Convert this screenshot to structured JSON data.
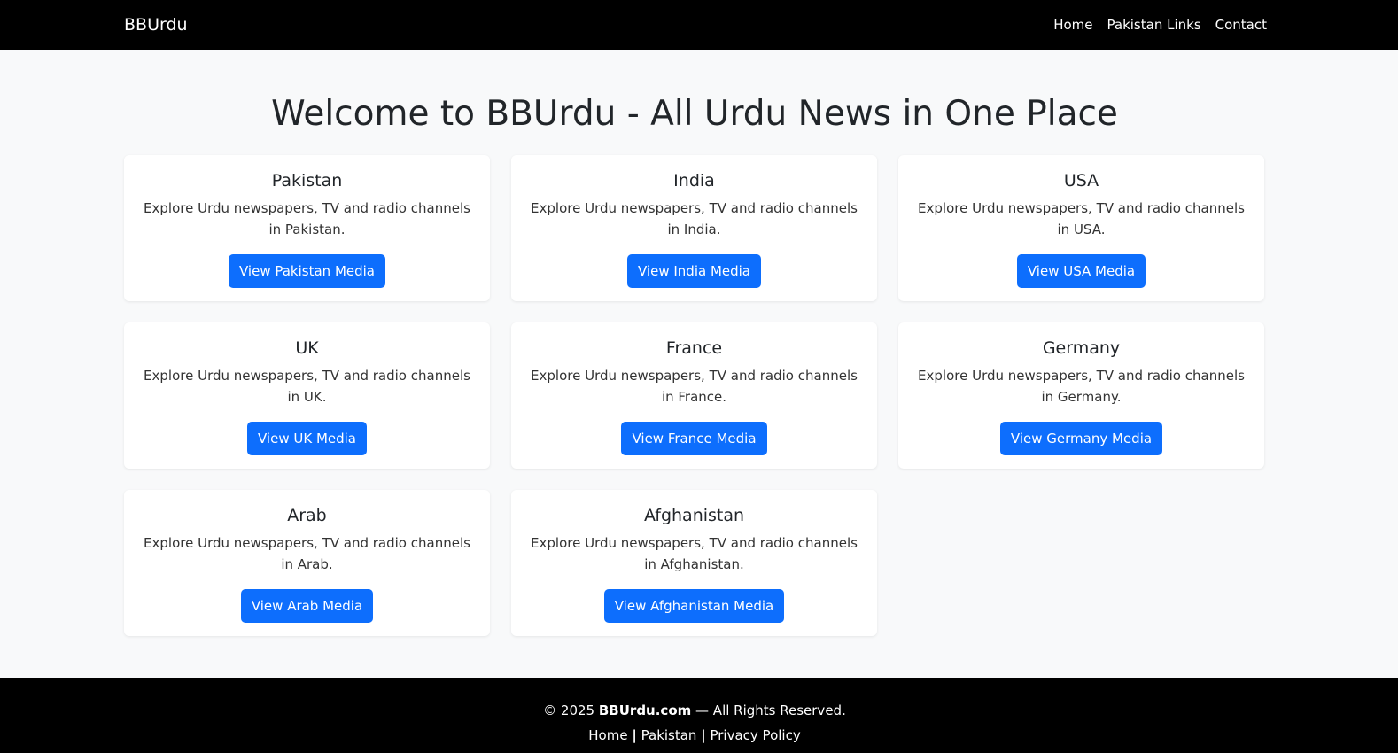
{
  "navbar": {
    "brand": "BBUrdu",
    "links": [
      "Home",
      "Pakistan Links",
      "Contact"
    ]
  },
  "hero": {
    "title": "Welcome to BBUrdu - All Urdu News in One Place"
  },
  "cards": [
    {
      "title": "Pakistan",
      "text": "Explore Urdu newspapers, TV and radio channels in Pakistan.",
      "button": "View Pakistan Media"
    },
    {
      "title": "India",
      "text": "Explore Urdu newspapers, TV and radio channels in India.",
      "button": "View India Media"
    },
    {
      "title": "USA",
      "text": "Explore Urdu newspapers, TV and radio channels in USA.",
      "button": "View USA Media"
    },
    {
      "title": "UK",
      "text": "Explore Urdu newspapers, TV and radio channels in UK.",
      "button": "View UK Media"
    },
    {
      "title": "France",
      "text": "Explore Urdu newspapers, TV and radio channels in France.",
      "button": "View France Media"
    },
    {
      "title": "Germany",
      "text": "Explore Urdu newspapers, TV and radio channels in Germany.",
      "button": "View Germany Media"
    },
    {
      "title": "Arab",
      "text": "Explore Urdu newspapers, TV and radio channels in Arab.",
      "button": "View Arab Media"
    },
    {
      "title": "Afghanistan",
      "text": "Explore Urdu newspapers, TV and radio channels in Afghanistan.",
      "button": "View Afghanistan Media"
    }
  ],
  "footer": {
    "copyright_prefix": "© 2025 ",
    "site_name": "BBUrdu.com",
    "copyright_suffix": " — All Rights Reserved.",
    "links": [
      "Home",
      "Pakistan",
      "Privacy Policy"
    ],
    "separator": "|"
  },
  "colors": {
    "navbar_bg": "#000000",
    "page_bg": "#f8f9fa",
    "button_bg": "#0d6efd",
    "footer_bg": "#000000"
  }
}
